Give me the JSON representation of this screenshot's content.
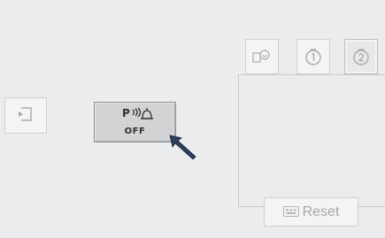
{
  "park_assist": {
    "symbol_letter": "P",
    "status_label": "OFF"
  },
  "reset": {
    "label": "Reset",
    "key_icon": "esc-key-icon"
  },
  "tabs": [
    {
      "icon": "camera-view-icon",
      "active": false
    },
    {
      "icon": "timer-1-icon",
      "active": false
    },
    {
      "icon": "timer-2-icon",
      "active": true
    }
  ],
  "exit": {
    "icon": "exit-icon"
  },
  "colors": {
    "background": "#ebecee",
    "active_button": "#d2d3d5",
    "cursor": "#2c3e5c",
    "disabled_text": "#a6a7a9"
  }
}
